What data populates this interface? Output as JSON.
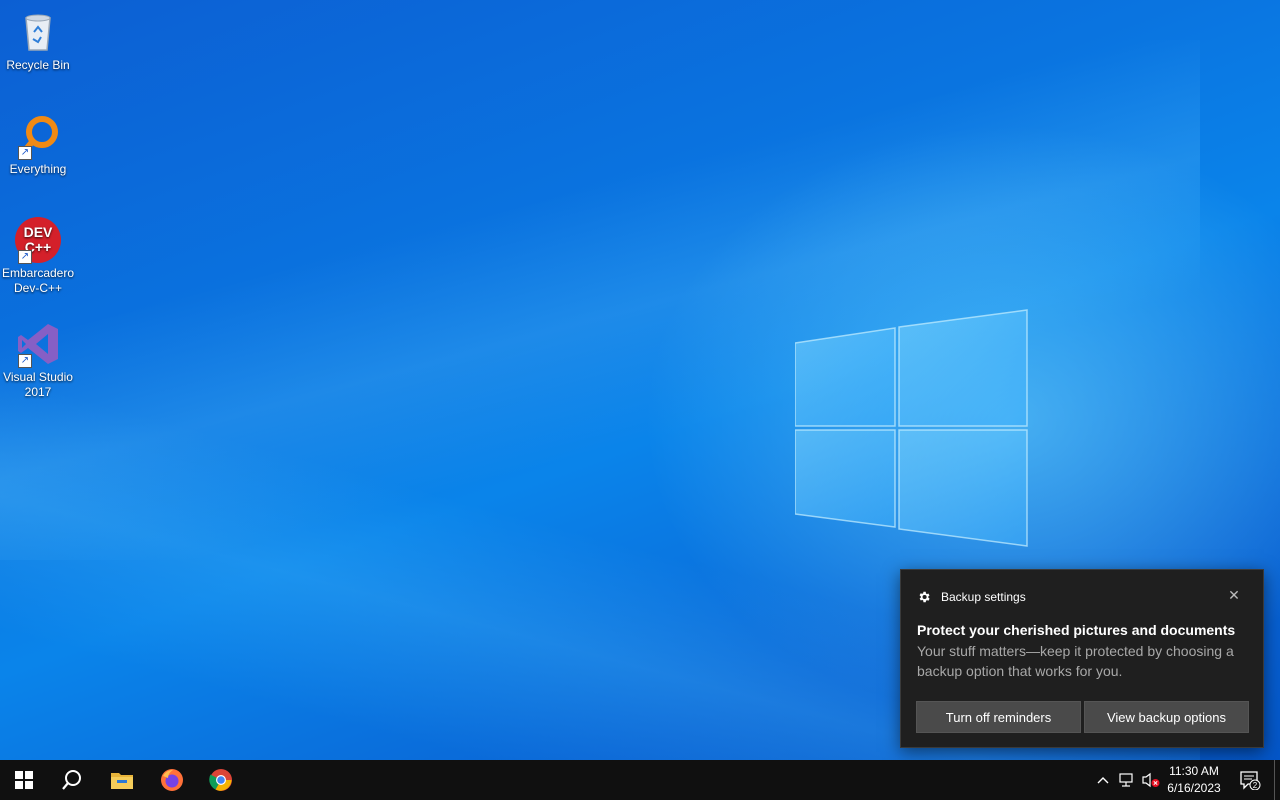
{
  "desktop": {
    "icons": [
      {
        "label": "Recycle Bin",
        "icon": "recycle-bin-icon"
      },
      {
        "label": "Everything",
        "icon": "everything-search-icon"
      },
      {
        "label": "Embarcadero Dev-C++",
        "icon": "devcpp-icon",
        "badge_text": "DEV\nC++"
      },
      {
        "label": "Visual Studio 2017",
        "icon": "visual-studio-icon"
      }
    ]
  },
  "toast": {
    "app_name": "Backup settings",
    "app_icon": "gear-icon",
    "close_glyph": "✕",
    "title": "Protect your cherished pictures and documents",
    "body": "Your stuff matters—keep it protected by choosing a backup option that works for you.",
    "buttons": [
      "Turn off reminders",
      "View backup options"
    ]
  },
  "taskbar": {
    "items": [
      "start-button",
      "search-button",
      "file-explorer",
      "firefox",
      "chrome"
    ],
    "tray": {
      "time": "11:30 AM",
      "date": "6/16/2023",
      "notification_count": "2"
    }
  },
  "colors": {
    "taskbar_bg": "#101010",
    "toast_bg": "#1f1f1f",
    "toast_button_bg": "#4a4a4a",
    "desktop_blue": "#0a74e0"
  }
}
